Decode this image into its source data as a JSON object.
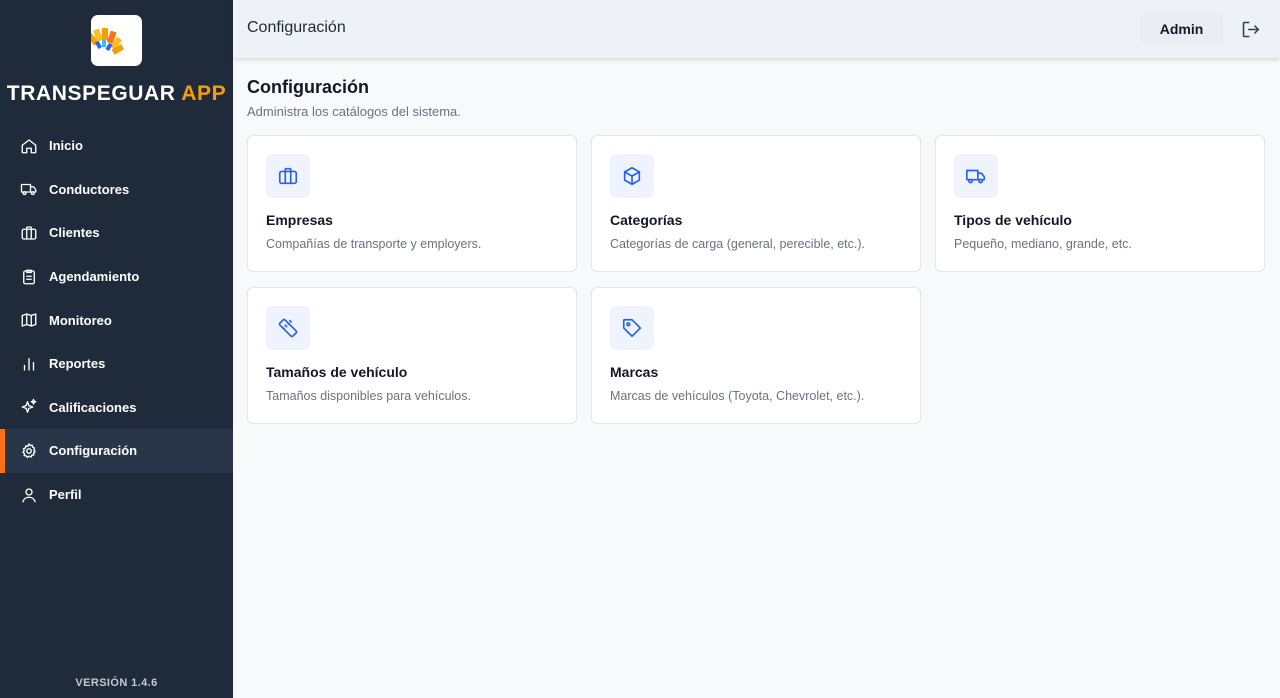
{
  "sidebar": {
    "brand_main": "TRANSPEGUAR",
    "brand_accent": "APP",
    "items": [
      {
        "label": "Inicio",
        "icon": "home-icon"
      },
      {
        "label": "Conductores",
        "icon": "truck-icon"
      },
      {
        "label": "Clientes",
        "icon": "briefcase-icon"
      },
      {
        "label": "Agendamiento",
        "icon": "clipboard-icon"
      },
      {
        "label": "Monitoreo",
        "icon": "map-icon"
      },
      {
        "label": "Reportes",
        "icon": "bar-chart-icon"
      },
      {
        "label": "Calificaciones",
        "icon": "sparkles-icon"
      },
      {
        "label": "Configuración",
        "icon": "gear-icon",
        "active": true
      },
      {
        "label": "Perfil",
        "icon": "user-icon"
      }
    ],
    "version": "VERSIÓN 1.4.6"
  },
  "header": {
    "title": "Configuración",
    "user_label": "Admin",
    "logout_icon": "logout-icon"
  },
  "main": {
    "title": "Configuración",
    "subtitle": "Administra los catálogos del sistema.",
    "cards": [
      {
        "title": "Empresas",
        "description": "Compañías de transporte y employers.",
        "icon": "briefcase-icon"
      },
      {
        "title": "Categorías",
        "description": "Categorías de carga (general, perecible, etc.).",
        "icon": "box-icon"
      },
      {
        "title": "Tipos de vehículo",
        "description": "Pequeño, mediano, grande, etc.",
        "icon": "truck-icon"
      },
      {
        "title": "Tamaños de vehículo",
        "description": "Tamaños disponibles para vehículos.",
        "icon": "ruler-icon"
      },
      {
        "title": "Marcas",
        "description": "Marcas de vehículos (Toyota, Chevrolet, etc.).",
        "icon": "tag-icon"
      }
    ]
  },
  "colors": {
    "sidebar_bg": "#1f2a3a",
    "accent": "#f59e0b",
    "active_bar": "#f97316",
    "icon_blue": "#2563eb"
  }
}
